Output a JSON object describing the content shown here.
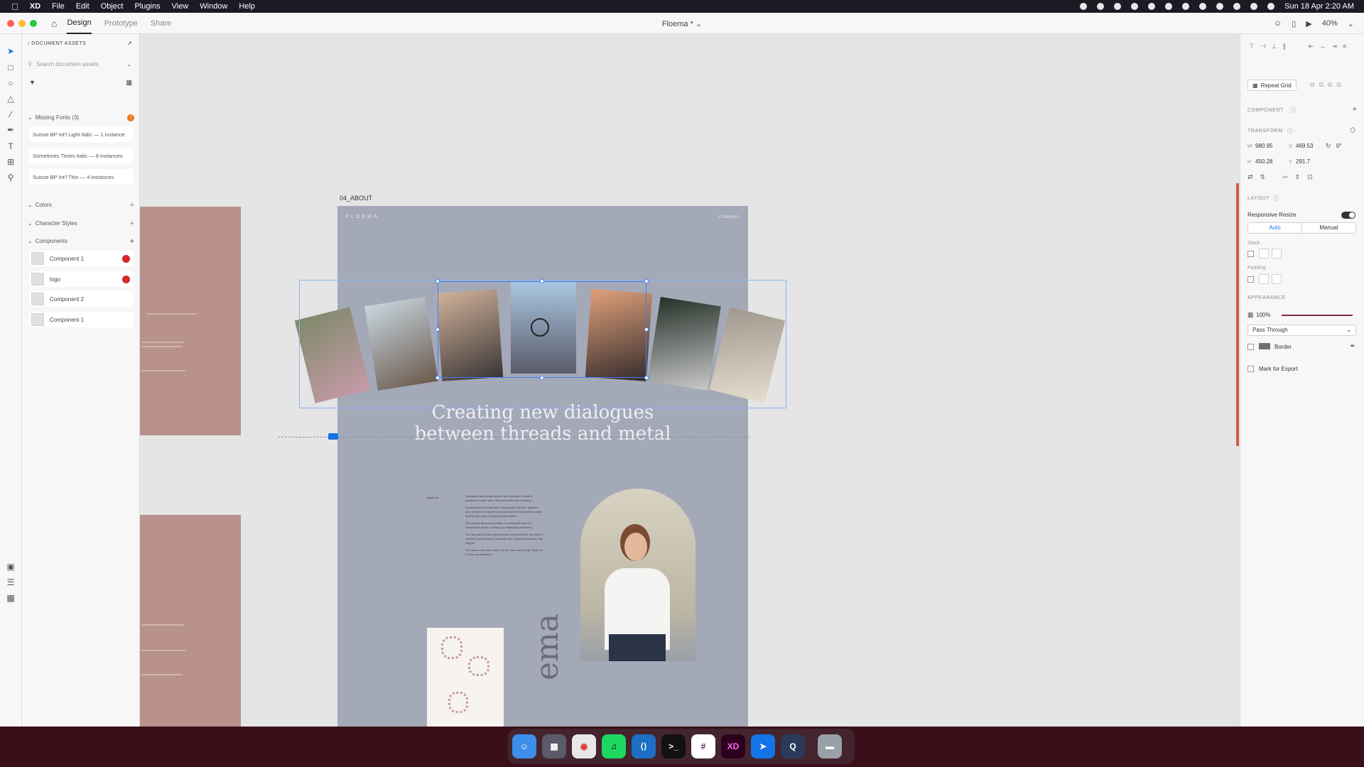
{
  "menubar": {
    "app_name": "XD",
    "menus": [
      "File",
      "Edit",
      "Object",
      "Plugins",
      "View",
      "Window",
      "Help"
    ],
    "datetime": "Sun 18 Apr  2:20 AM"
  },
  "titlebar": {
    "tabs": [
      "Design",
      "Prototype",
      "Share"
    ],
    "document_title": "Floema *",
    "zoom": "40%"
  },
  "assets": {
    "header": "DOCUMENT ASSETS",
    "search_placeholder": "Search document assets",
    "missing_fonts_label": "Missing Fonts (3)",
    "missing_fonts": [
      "Suisse BP Int'l Light Italic — 1 instance",
      "Sometimes Times Italic — 8 instances",
      "Suisse BP Int'l Thin — 4 instances"
    ],
    "colors_label": "Colors",
    "character_styles_label": "Character Styles",
    "components_label": "Components",
    "components": [
      "Component 1",
      "logo",
      "Component 2",
      "Component 1"
    ]
  },
  "canvas": {
    "artboard_label": "04_ABOUT",
    "brand": "FLOEMA",
    "nav_right": "Collections",
    "headline_line1": "Creating new dialogues",
    "headline_line2": "between threads and metal",
    "about_label": "about me",
    "vertical_text": "ema",
    "bio_paragraphs": [
      "Valentina's work plays around the proximity of what is possible to make with a thread and the line of thread.",
      "Coming from a family with a strong knot and lace tradition, she decided to bring the ancestral art into the jewellery world, finding new ways of working with textiles.",
      "She always faces the problem of making threads in a harmonious dance, making it a challenging discovery.",
      "Her approach is both experimental and traditional: she likes to combine contemporary materials with ancient techniques, like Filigree.",
      "The latest work was chosen by the Triennale Design Museum to show its collection."
    ]
  },
  "properties": {
    "repeat_grid": "Repeat Grid",
    "component_label": "COMPONENT",
    "transform_label": "TRANSFORM",
    "w_label": "W",
    "w": "980.95",
    "x_label": "X",
    "x": "469.53",
    "rotation": "0°",
    "h_label": "H",
    "h": "450.28",
    "y_label": "Y",
    "y": "291.7",
    "layout_label": "LAYOUT",
    "responsive_resize": "Responsive Resize",
    "auto": "Auto",
    "manual": "Manual",
    "stack": "Stack",
    "padding": "Padding",
    "appearance_label": "APPEARANCE",
    "opacity": "100%",
    "opacity_value": 1.0,
    "blend_mode": "Pass Through",
    "border": "Border",
    "mark_export": "Mark for Export"
  },
  "dock": {
    "apps": [
      "Finder",
      "Launchpad",
      "Chrome",
      "Spotify",
      "VS Code",
      "Terminal",
      "Slack",
      "XD",
      "Maps",
      "QuickTime",
      "Trash"
    ]
  },
  "colors": {
    "artboard_bg": "#a4a9b8",
    "side_artboard": "#b8918a",
    "selection": "#3b82f6",
    "accent_red": "#d65a4a",
    "menubar": "#1b1b26"
  }
}
